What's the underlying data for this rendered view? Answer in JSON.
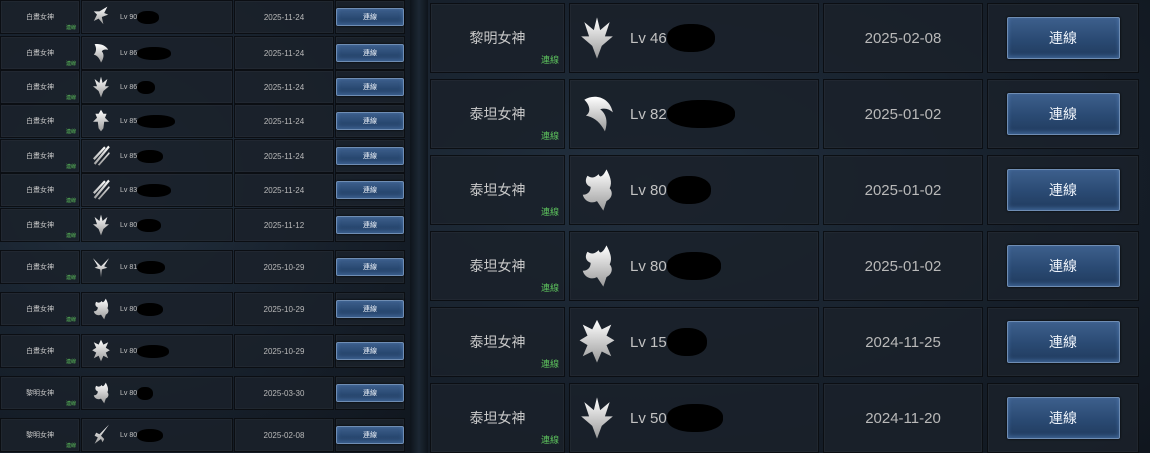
{
  "left_list": {
    "rows": [
      {
        "server": "白晝女神",
        "tag": "連線",
        "icon": "dark-mage-icon",
        "level": "Lv 90",
        "date": "2025-11-24",
        "button": "連線"
      },
      {
        "server": "白晝女神",
        "tag": "連線",
        "icon": "titan-icon",
        "level": "Lv 86",
        "date": "2025-11-24",
        "button": "連線"
      },
      {
        "server": "白晝女神",
        "tag": "連線",
        "icon": "crown-icon",
        "level": "Lv 86",
        "date": "2025-11-24",
        "button": "連線"
      },
      {
        "server": "白晝女神",
        "tag": "連線",
        "icon": "knight-icon",
        "level": "Lv 85",
        "date": "2025-11-24",
        "button": "連線"
      },
      {
        "server": "白晝女神",
        "tag": "連線",
        "icon": "warrior-icon",
        "level": "Lv 85",
        "date": "2025-11-24",
        "button": "連線"
      },
      {
        "server": "白晝女神",
        "tag": "連線",
        "icon": "warrior-icon",
        "level": "Lv 83",
        "date": "2025-11-24",
        "button": "連線"
      },
      {
        "server": "白晝女神",
        "tag": "連線",
        "icon": "crown-icon",
        "level": "Lv 80",
        "date": "2025-11-12",
        "button": "連線"
      },
      {
        "server": "白晝女神",
        "tag": "連線",
        "icon": "elf-icon",
        "level": "Lv 81",
        "date": "2025-10-29",
        "button": "連線"
      },
      {
        "server": "白晝女神",
        "tag": "連線",
        "icon": "dragon-icon",
        "level": "Lv 80",
        "date": "2025-10-29",
        "button": "連線"
      },
      {
        "server": "白晝女神",
        "tag": "連線",
        "icon": "beast-icon",
        "level": "Lv 80",
        "date": "2025-10-29",
        "button": "連線"
      },
      {
        "server": "黎明女神",
        "tag": "連線",
        "icon": "dragon-icon",
        "level": "Lv 80",
        "date": "2025-03-30",
        "button": "連線"
      },
      {
        "server": "黎明女神",
        "tag": "連線",
        "icon": "lancer-icon",
        "level": "Lv 80",
        "date": "2025-02-08",
        "button": "連線"
      }
    ]
  },
  "right_list": {
    "rows": [
      {
        "server": "黎明女神",
        "tag": "連線",
        "icon": "crown-icon",
        "level": "Lv 46",
        "date": "2025-02-08",
        "button": "連線"
      },
      {
        "server": "泰坦女神",
        "tag": "連線",
        "icon": "wing-icon",
        "level": "Lv 82",
        "date": "2025-01-02",
        "button": "連線"
      },
      {
        "server": "泰坦女神",
        "tag": "連線",
        "icon": "dragon-icon",
        "level": "Lv 80",
        "date": "2025-01-02",
        "button": "連線"
      },
      {
        "server": "泰坦女神",
        "tag": "連線",
        "icon": "dragon-icon",
        "level": "Lv 80",
        "date": "2025-01-02",
        "button": "連線"
      },
      {
        "server": "泰坦女神",
        "tag": "連線",
        "icon": "beast-icon",
        "level": "Lv 15",
        "date": "2024-11-25",
        "button": "連線"
      },
      {
        "server": "泰坦女神",
        "tag": "連線",
        "icon": "crown-icon",
        "level": "Lv 50",
        "date": "2024-11-20",
        "button": "連線"
      }
    ]
  },
  "colors": {
    "tag_green": "#5cc05c",
    "button_blue": "#2a4a73",
    "cell_dark": "#1a212a"
  }
}
